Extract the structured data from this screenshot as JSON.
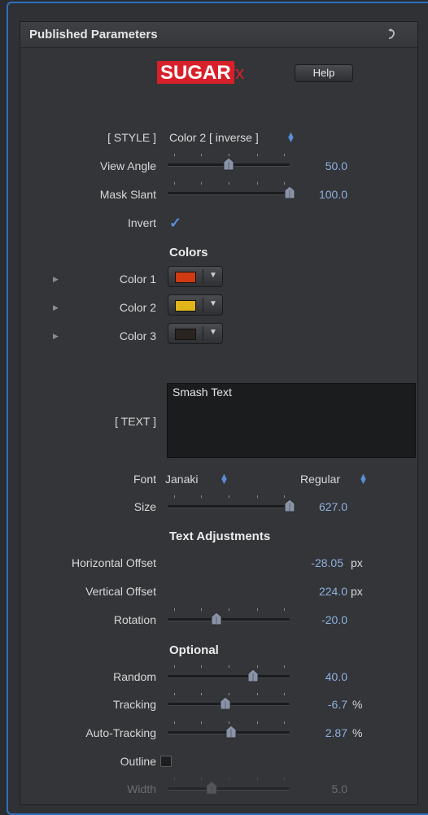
{
  "panel": {
    "title": "Published Parameters"
  },
  "logo": {
    "brand": "SUGAR",
    "suffix": "fx"
  },
  "help_button": "Help",
  "style": {
    "label": "[ STYLE ]",
    "value": "Color 2 [ inverse ]"
  },
  "view_angle": {
    "label": "View Angle",
    "value": "50.0",
    "level": 0.5
  },
  "mask_slant": {
    "label": "Mask Slant",
    "value": "100.0",
    "level": 1.0
  },
  "invert": {
    "label": "Invert",
    "checked": true
  },
  "colors": {
    "heading": "Colors",
    "items": [
      {
        "label": "Color 1",
        "color": "#cf3a12"
      },
      {
        "label": "Color 2",
        "color": "#e0b41a"
      },
      {
        "label": "Color 3",
        "color": "#2a2420"
      }
    ]
  },
  "text": {
    "label": "[ TEXT ]",
    "value": "Smash Text"
  },
  "font": {
    "label": "Font",
    "family": "Janaki",
    "style": "Regular"
  },
  "size": {
    "label": "Size",
    "value": "627.0",
    "level": 1.0
  },
  "text_adjustments": {
    "heading": "Text Adjustments",
    "horizontal_offset": {
      "label": "Horizontal Offset",
      "value": "-28.05",
      "unit": "px"
    },
    "vertical_offset": {
      "label": "Vertical Offset",
      "value": "224.0",
      "unit": "px"
    },
    "rotation": {
      "label": "Rotation",
      "value": "-20.0",
      "level": 0.4
    }
  },
  "optional": {
    "heading": "Optional",
    "random": {
      "label": "Random",
      "value": "40.0",
      "level": 0.7
    },
    "tracking": {
      "label": "Tracking",
      "value": "-6.7",
      "unit": "%",
      "level": 0.47
    },
    "auto_tracking": {
      "label": "Auto-Tracking",
      "value": "2.87",
      "unit": "%",
      "level": 0.52
    },
    "outline": {
      "label": "Outline",
      "checked": false
    },
    "width": {
      "label": "Width",
      "value": "5.0",
      "level": 0.36
    }
  },
  "accent_color": "#5b8ed8",
  "value_color": "#8fb0e0"
}
